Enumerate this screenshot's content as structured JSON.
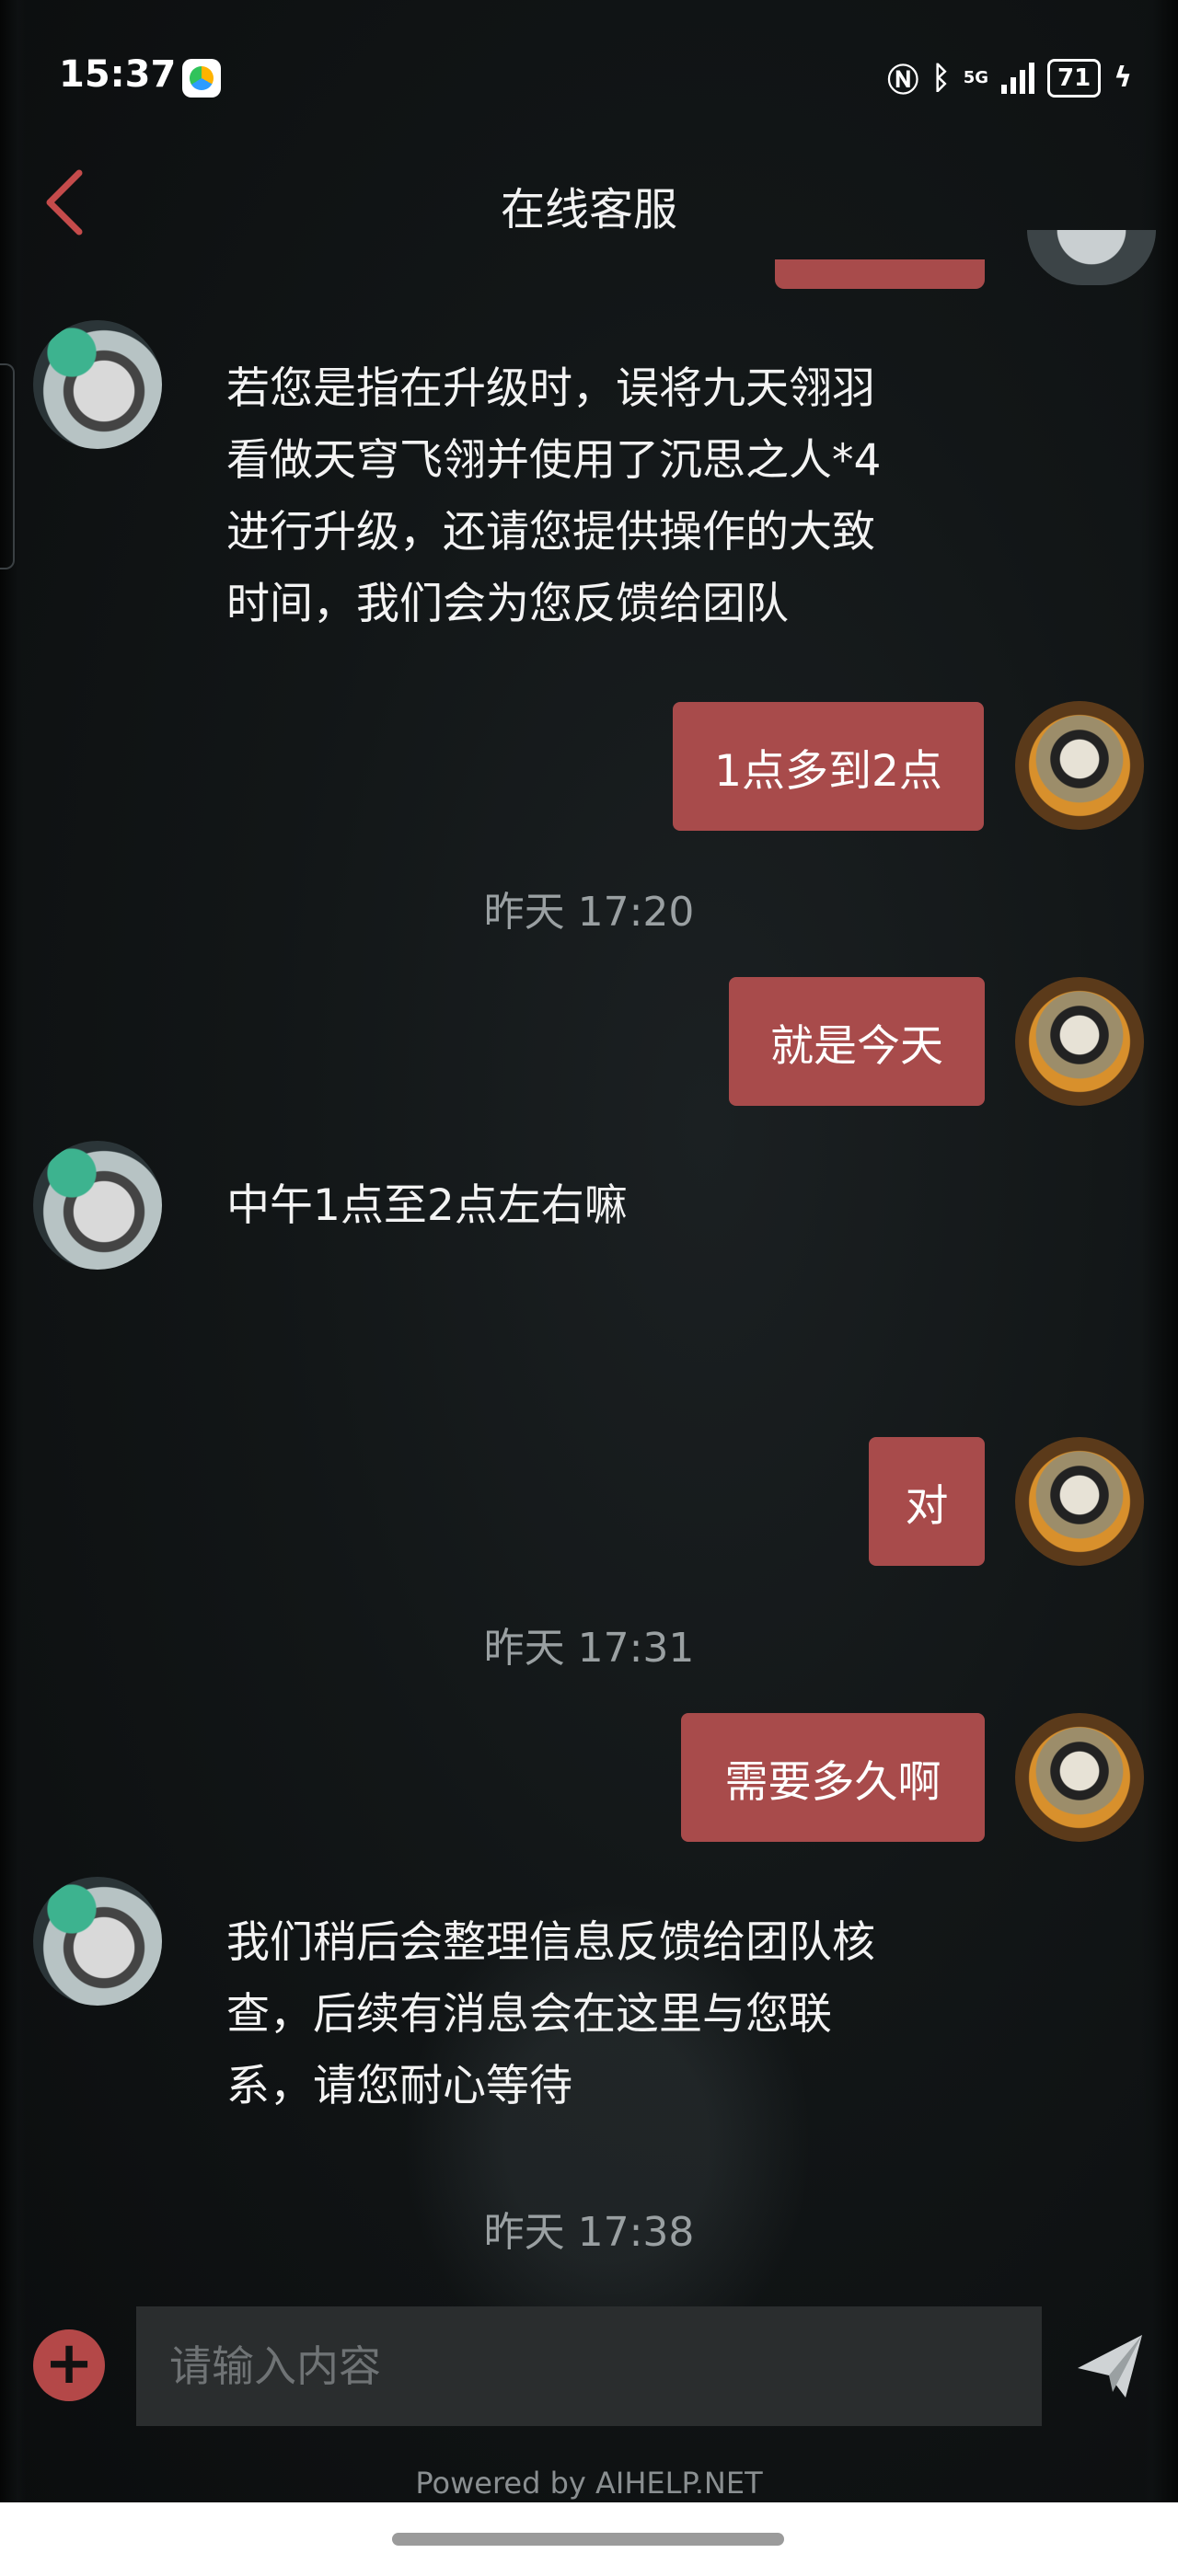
{
  "status_bar": {
    "time": "15:37",
    "network": "5G",
    "battery": "71",
    "icons": [
      "app-icon",
      "nfc-icon",
      "bluetooth-icon",
      "signal-icon",
      "battery-icon",
      "charging-icon"
    ]
  },
  "header": {
    "title": "在线客服",
    "back_icon": "chevron-left-icon"
  },
  "messages": {
    "m1_lines": [
      "若您是指在升级时，误将九天翎羽",
      "看做天穹飞翎并使用了沉思之人*4",
      "进行升级，还请您提供操作的大致",
      "时间，我们会为您反馈给团队"
    ],
    "m2": "1点多到2点",
    "ts1": "昨天 17:20",
    "m3": "就是今天",
    "m4": "中午1点至2点左右嘛",
    "m5": "对",
    "ts2": "昨天 17:31",
    "m6": "需要多久啊",
    "m7_lines": [
      "我们稍后会整理信息反馈给团队核",
      "查，后续有消息会在这里与您联",
      "系，请您耐心等待"
    ],
    "ts3": "昨天 17:38"
  },
  "composer": {
    "placeholder": "请输入内容",
    "plus_icon": "plus-icon",
    "send_icon": "send-icon"
  },
  "footer": {
    "powered": "Powered by AIHELP.NET"
  },
  "colors": {
    "accent": "#a84b4b",
    "background": "#0f1213",
    "timestamp": "#9aa0a2"
  }
}
